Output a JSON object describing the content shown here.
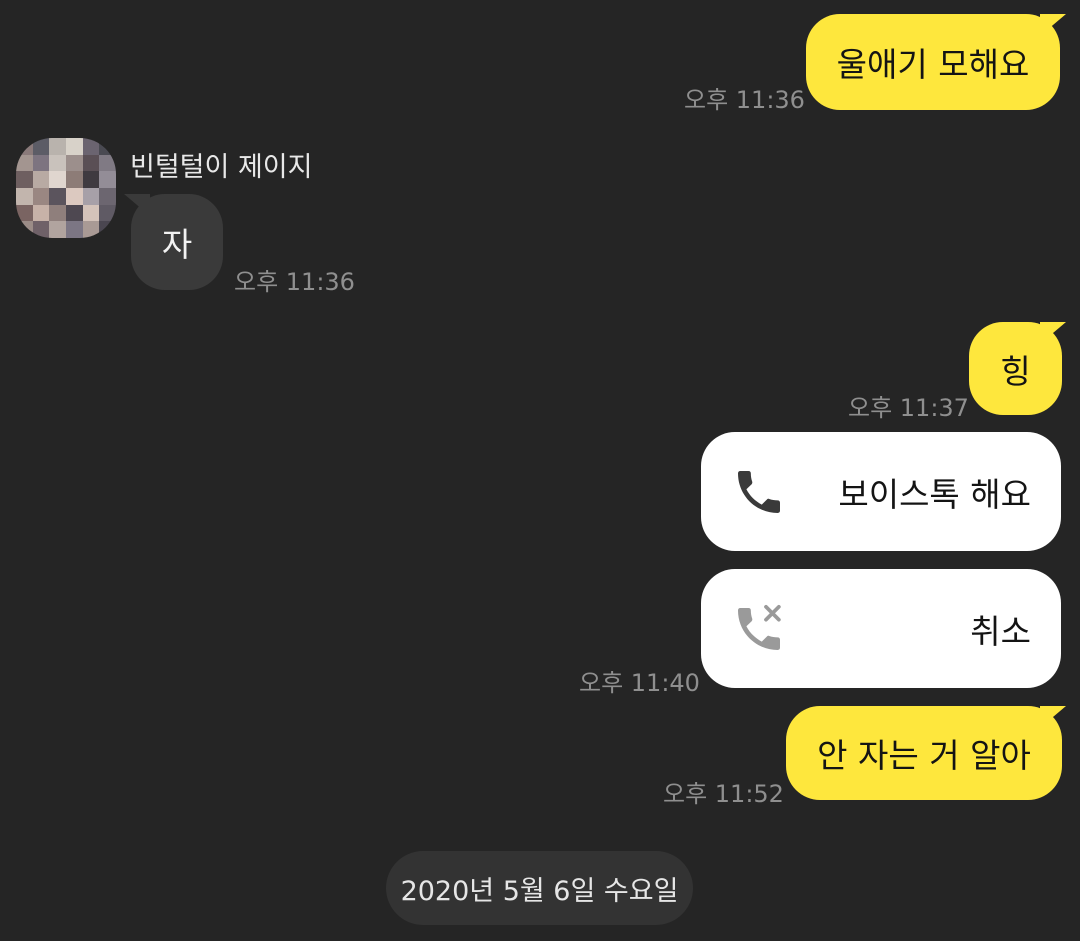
{
  "messages": {
    "m1": {
      "text": "울애기 모해요",
      "time": "오후 11:36"
    },
    "m2": {
      "sender": "빈털털이 제이지",
      "text": "자",
      "time": "오후 11:36"
    },
    "m3": {
      "text": "힝",
      "time": "오후 11:37"
    },
    "m4": {
      "label": "보이스톡 해요",
      "icon": "phone-icon"
    },
    "m5": {
      "label": "취소",
      "icon": "phone-cancelled-icon",
      "time": "오후 11:40"
    },
    "m6": {
      "text": "안 자는 거 알아",
      "time": "오후 11:52"
    }
  },
  "date_divider": "2020년 5월 6일 수요일",
  "colors": {
    "background": "#252525",
    "my_bubble": "#fee73d",
    "other_bubble": "#3a3a3a",
    "call_card": "#ffffff",
    "time_text": "#8f8f8f",
    "date_pill": "#333333"
  },
  "avatar": {
    "icon": "avatar-pixelated",
    "pixels": [
      "#8a7a7a",
      "#5c5c66",
      "#b9b3ad",
      "#d8d2c9",
      "#6b6470",
      "#4a4a52",
      "#a39590",
      "#7d7480",
      "#c9c2bc",
      "#9c8f8c",
      "#5a4f55",
      "#807a84",
      "#6e5f60",
      "#b8aaa3",
      "#e0d6cf",
      "#8d7c77",
      "#3f3a40",
      "#938d97",
      "#c2b5ad",
      "#9a8782",
      "#5b545d",
      "#dcc9c0",
      "#a7a0a8",
      "#6c6670",
      "#7a6462",
      "#c7b2a8",
      "#8f7f7c",
      "#4e4851",
      "#d4c3ba",
      "#5f5a64",
      "#9b8c87",
      "#6f6168",
      "#b1a49f",
      "#7c7684",
      "#a99a95",
      "#4a4650"
    ]
  }
}
